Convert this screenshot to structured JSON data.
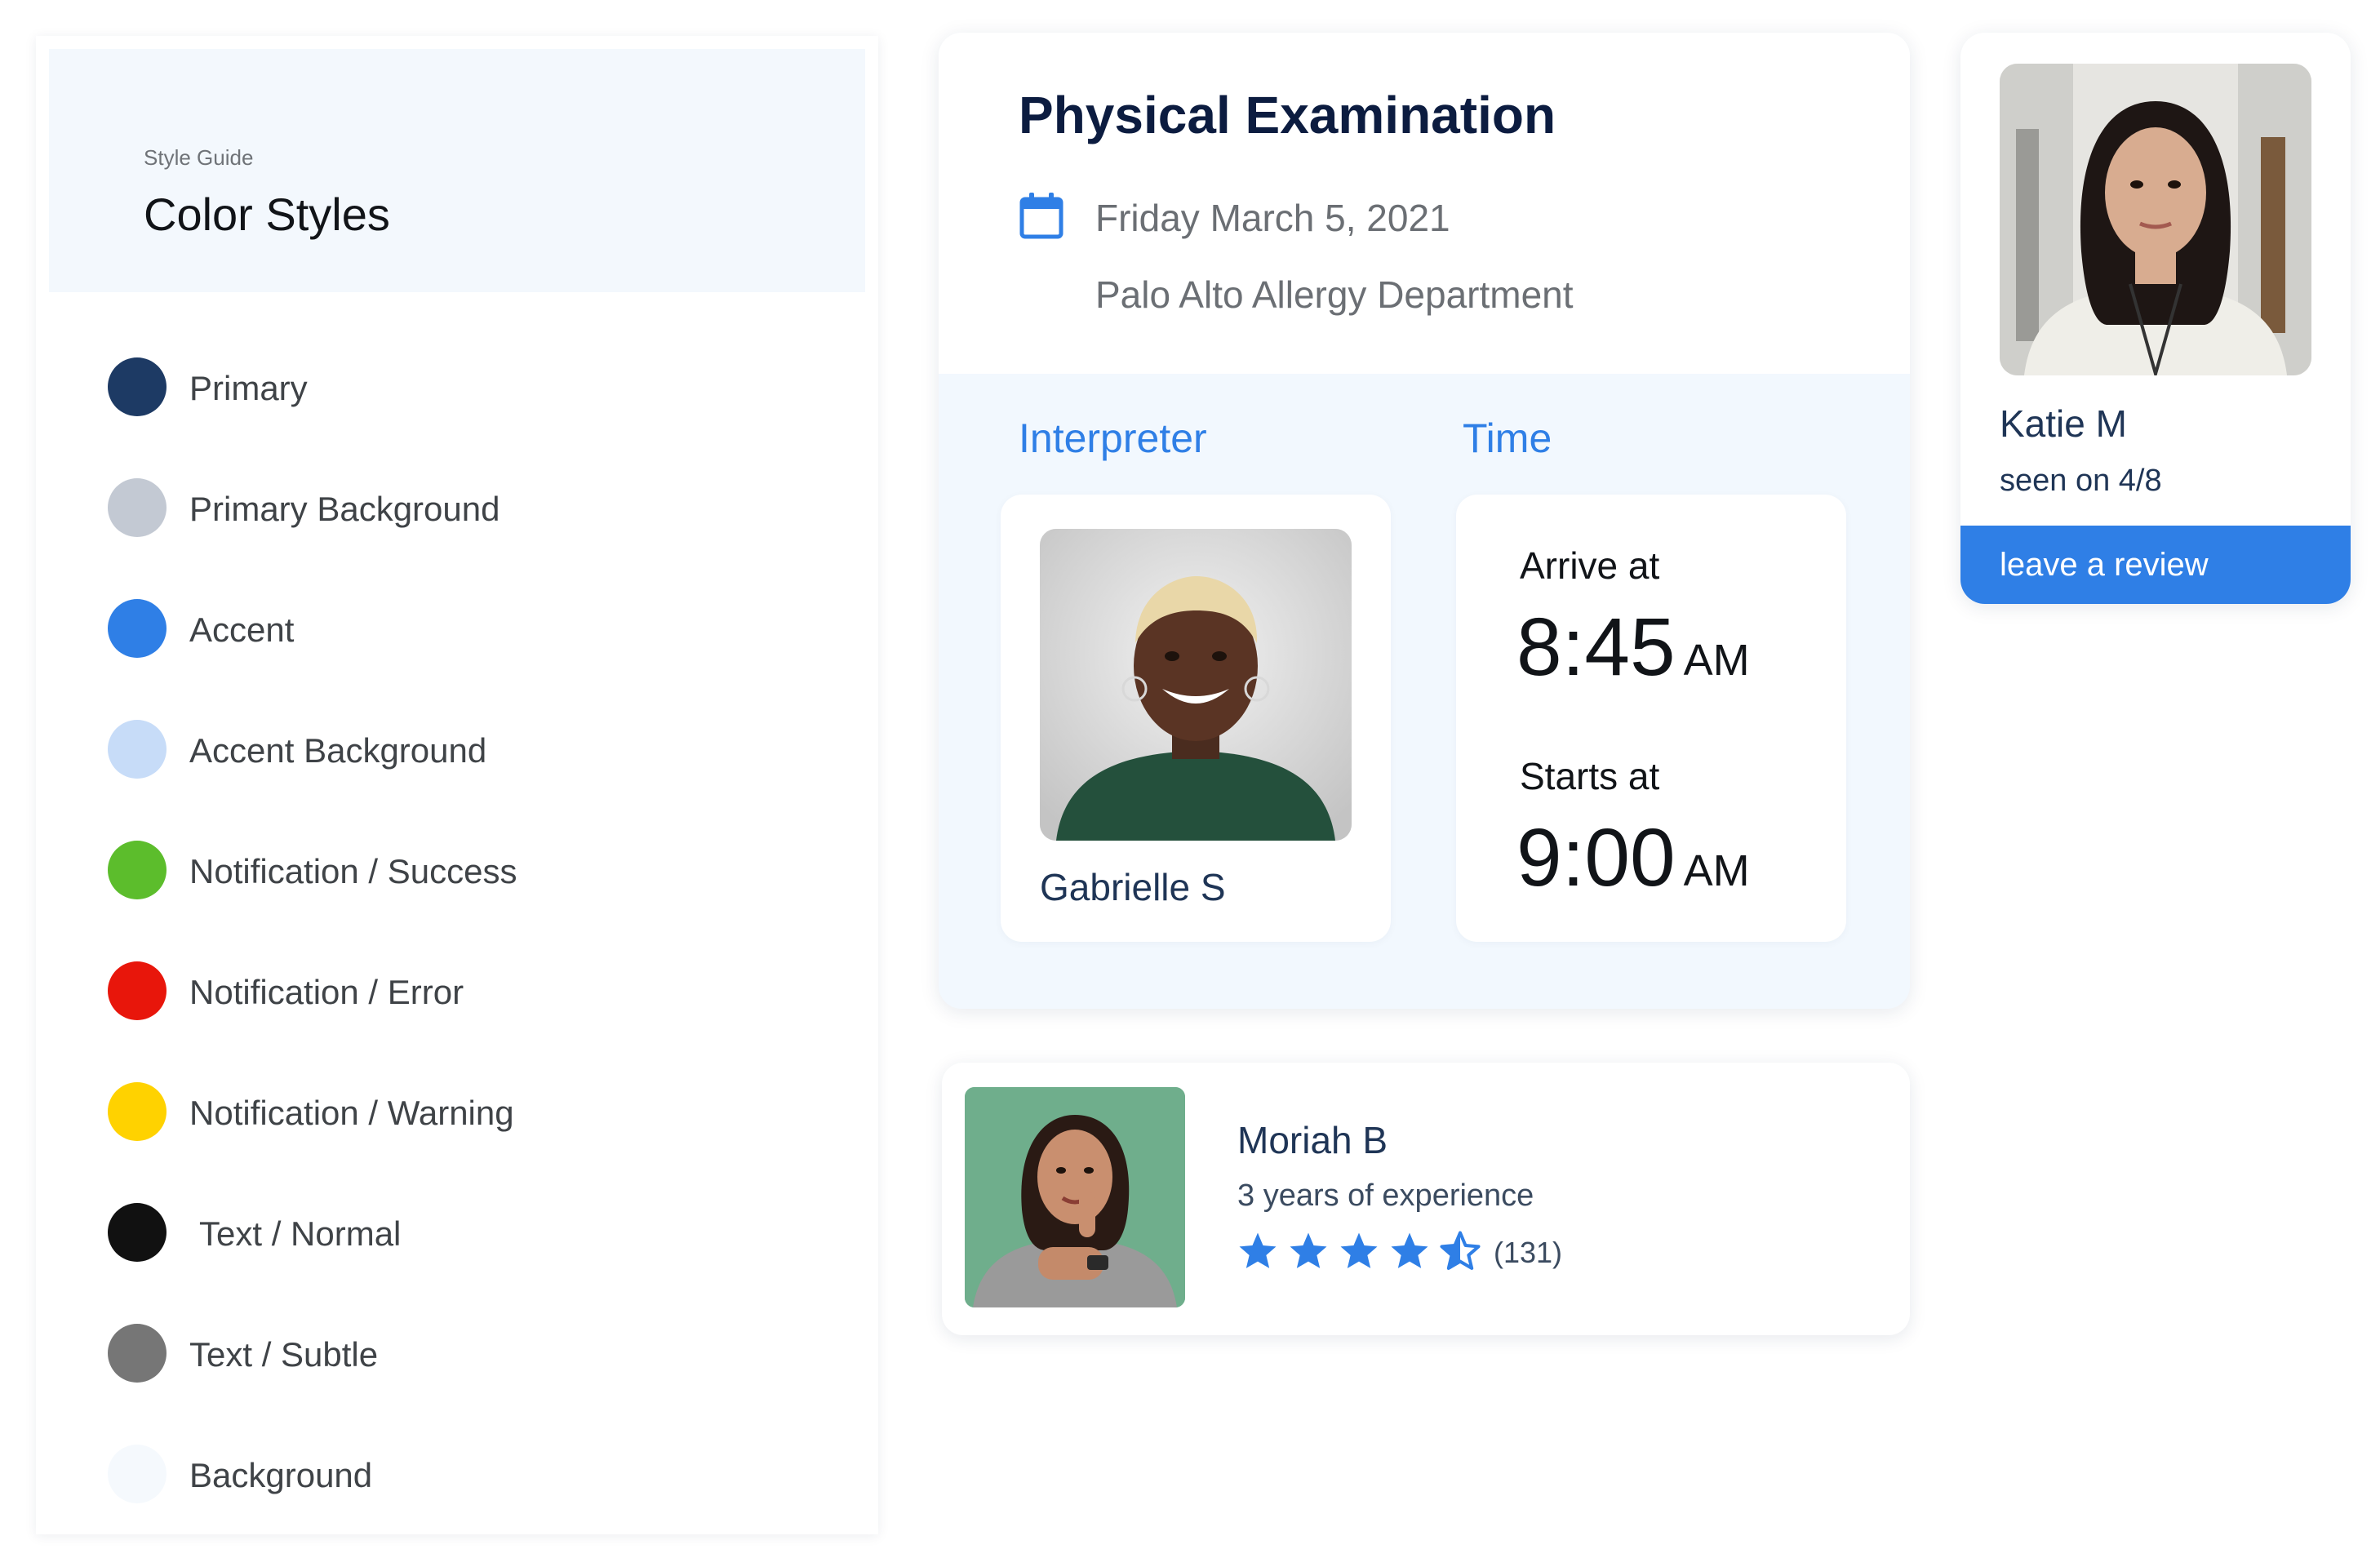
{
  "style_guide": {
    "eyebrow": "Style Guide",
    "title": "Color Styles",
    "swatches": [
      {
        "label": "Primary",
        "color": "#1d3a64"
      },
      {
        "label": "Primary Background",
        "color": "#c3c9d3"
      },
      {
        "label": "Accent",
        "color": "#2f7fe6"
      },
      {
        "label": "Accent Background",
        "color": "#c7dcf8"
      },
      {
        "label": "Notification / Success",
        "color": "#5cbd2c"
      },
      {
        "label": "Notification / Error",
        "color": "#e8160b"
      },
      {
        "label": "Notification / Warning",
        "color": "#ffd200"
      },
      {
        "label": "Text / Normal",
        "color": "#111111"
      },
      {
        "label": "Text / Subtle",
        "color": "#767676"
      },
      {
        "label": "Background",
        "color": "#f5f9fd"
      }
    ]
  },
  "appointment": {
    "title": "Physical Examination",
    "date": "Friday March 5, 2021",
    "department": "Palo Alto Allergy Department",
    "interpreter_label": "Interpreter",
    "time_label": "Time",
    "interpreter": {
      "name": "Gabrielle S"
    },
    "arrive": {
      "caption": "Arrive at",
      "time": "8:45",
      "ampm": "AM"
    },
    "start": {
      "caption": "Starts at",
      "time": "9:00",
      "ampm": "AM"
    }
  },
  "interpreter_card": {
    "name": "Moriah B",
    "experience": "3 years of experience",
    "rating": 4.5,
    "rating_max": 5,
    "review_count": "(131)"
  },
  "provider_card": {
    "name": "Katie M",
    "seen": "seen on 4/8",
    "button_label": "leave a review"
  },
  "colors": {
    "accent": "#2f7fe6",
    "primary": "#1d3a64",
    "card_bg": "#f2f8fe"
  },
  "icons": {
    "calendar": "calendar-icon",
    "star_full": "star-icon",
    "star_half": "star-half-icon"
  }
}
